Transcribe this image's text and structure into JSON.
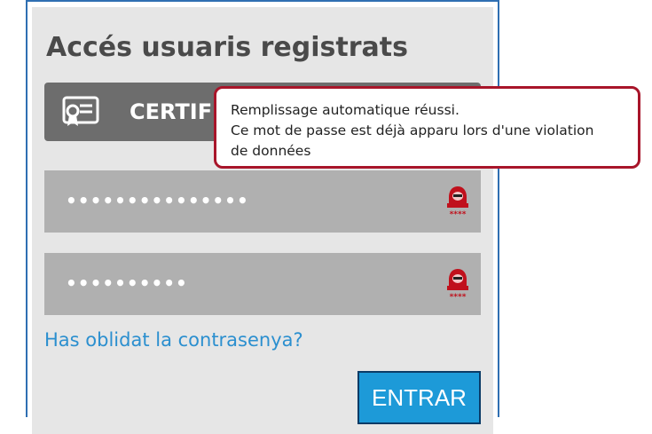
{
  "panel": {
    "title": "Accés usuaris registrats",
    "certificate_button": {
      "label": "CERTIFICAT",
      "icon": "certificate-icon"
    },
    "password_fields": [
      {
        "value": "•••••••••••••••",
        "icon": "hacker-warning-icon"
      },
      {
        "value": "••••••••••",
        "icon": "hacker-warning-icon"
      }
    ],
    "forgot_link": "Has oblidat la contrasenya?",
    "submit_label": "ENTRAR"
  },
  "tooltip": {
    "line1": "Remplissage automatique réussi.",
    "line2": "Ce mot de passe est déjà apparu lors d'une violation",
    "line3": "de données"
  },
  "colors": {
    "panel_bg": "#e6e6e6",
    "certificate_bg": "#6d6d6d",
    "field_bg": "#b0b0b0",
    "link": "#2b8fcf",
    "button": "#1d9ad8",
    "tooltip_border": "#a8152a",
    "warning_icon": "#c0101c"
  }
}
